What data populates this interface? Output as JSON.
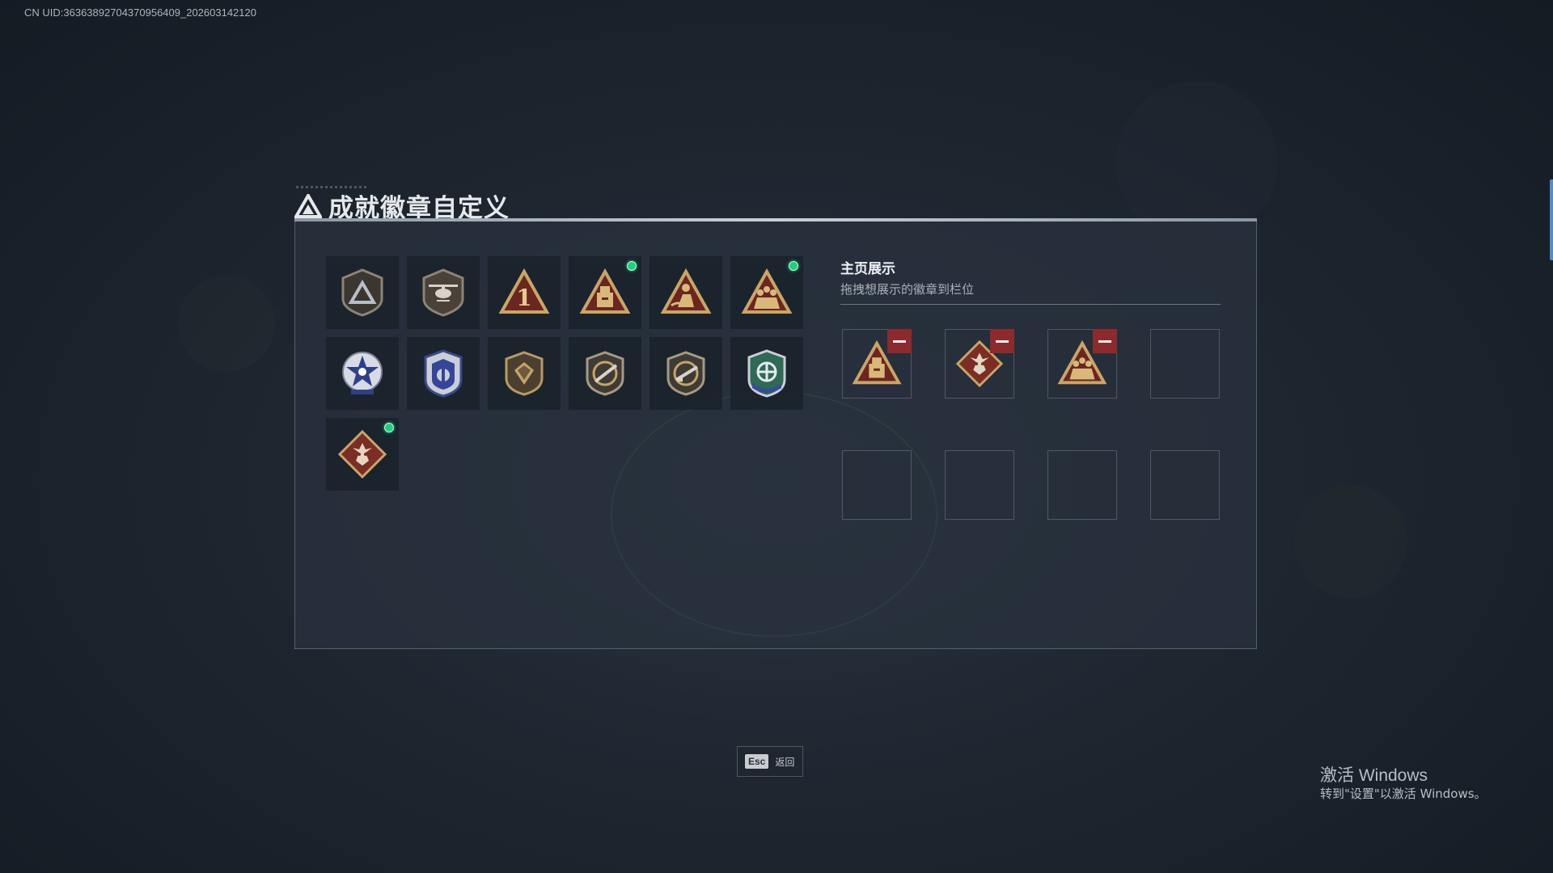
{
  "overlay": {
    "uid": "CN UID:3636389270437095640​9_202603142120"
  },
  "dialog": {
    "title": "成就徽章自定义"
  },
  "badges": [
    {
      "icon": "shield-triangle-badge-icon",
      "new": false
    },
    {
      "icon": "helicopter-badge-icon",
      "new": false
    },
    {
      "icon": "rank-one-badge-icon",
      "new": false
    },
    {
      "icon": "supply-crate-badge-icon",
      "new": true
    },
    {
      "icon": "runner-badge-icon",
      "new": false
    },
    {
      "icon": "squad-badge-icon",
      "new": true
    },
    {
      "icon": "star-medal-badge-icon",
      "new": false
    },
    {
      "icon": "police-shield-badge-icon",
      "new": false
    },
    {
      "icon": "gem-shield-badge-icon",
      "new": false
    },
    {
      "icon": "rifle-shield-badge-icon",
      "new": false
    },
    {
      "icon": "rifle-shield-badge-icon-2",
      "new": false
    },
    {
      "icon": "emblem-crest-badge-icon",
      "new": false
    },
    {
      "icon": "dragon-badge-icon",
      "new": true
    }
  ],
  "showcase": {
    "title": "主页展示",
    "subtitle": "拖拽想展示的徽章到栏位",
    "slots": [
      "supply-crate-badge-icon",
      "dragon-badge-icon",
      "squad-badge-icon",
      "",
      "",
      "",
      "",
      ""
    ]
  },
  "footer": {
    "esc_key": "Esc",
    "esc_label": "返回"
  },
  "windows_watermark": {
    "title": "激活 Windows",
    "subtitle": "转到\"设置\"以激活 Windows。"
  },
  "colors": {
    "new_dot": "#1bd17c",
    "remove": "#8c2a2e",
    "gold": "#c9a567",
    "silver": "#b8bfc8"
  }
}
